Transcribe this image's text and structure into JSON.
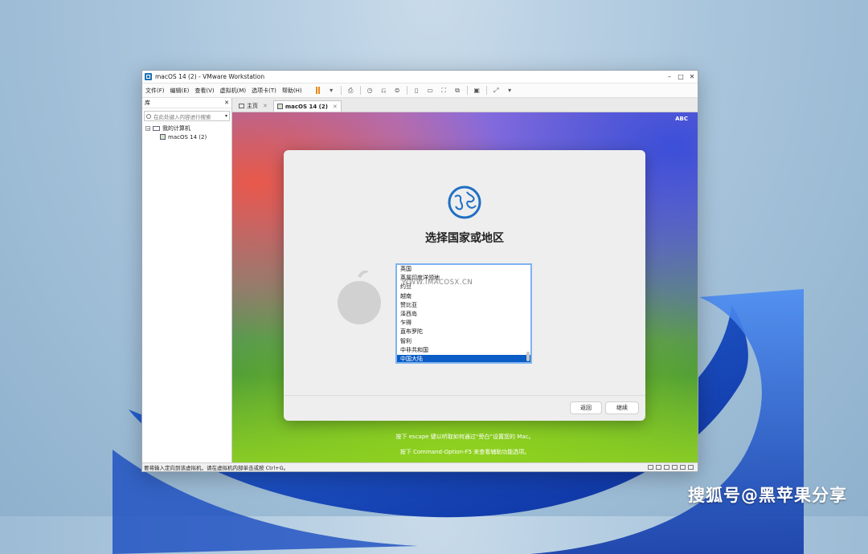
{
  "window": {
    "title": "macOS 14 (2) - VMware Workstation",
    "controls": [
      "–",
      "□",
      "✕"
    ]
  },
  "menubar": [
    "文件(F)",
    "编辑(E)",
    "查看(V)",
    "虚拟机(M)",
    "选项卡(T)",
    "帮助(H)"
  ],
  "library": {
    "title": "库",
    "close": "✕",
    "search_placeholder": "在此处键入内容进行搜索",
    "root": "我的计算机",
    "vm": "macOS 14 (2)"
  },
  "tabs": [
    {
      "label": "主页",
      "close": "✕"
    },
    {
      "label": "macOS 14 (2)",
      "close": "✕"
    }
  ],
  "guest": {
    "input_indicator": "ABC",
    "dialog_title": "选择国家或地区",
    "countries": [
      "英国",
      "英属印度洋领地",
      "约旦",
      "越南",
      "赞比亚",
      "泽西岛",
      "乍得",
      "直布罗陀",
      "智利",
      "中非共和国",
      "中国大陆"
    ],
    "selected_country": "中国大陆",
    "back_button": "返回",
    "continue_button": "继续",
    "hint1": "按下 escape 键以听取如何通过“旁白”设置您的 Mac。",
    "hint2": "按下 Command-Option-F5 来查看辅助功能选项。",
    "watermark_url": "WWW.IMACOSX.CN"
  },
  "statusbar": {
    "text": "要将输入定向到该虚拟机，请在虚拟机内部单击或按 Ctrl+G。"
  },
  "corner_watermark": "搜狐号@黑苹果分享",
  "colors": {
    "accent": "#0b5cc5",
    "pause": "#e8891b",
    "globe": "#1f6fc4"
  }
}
